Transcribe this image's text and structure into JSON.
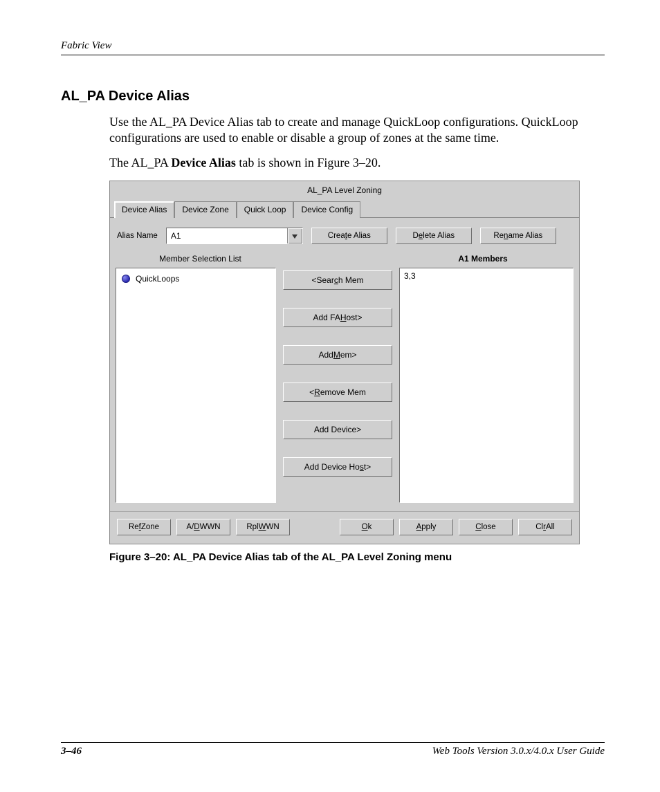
{
  "page": {
    "running_head": "Fabric View",
    "section_title": "AL_PA Device Alias",
    "para1": "Use the AL_PA Device Alias tab to create and manage QuickLoop configurations. QuickLoop configurations are used to enable or disable a group of zones at the same time.",
    "para2_pre": "The AL_PA ",
    "para2_bold": "Device Alias",
    "para2_post": " tab is shown in Figure 3–20.",
    "figure_caption": "Figure 3–20:  AL_PA Device Alias tab of the AL_PA Level Zoning menu",
    "footer_page": "3–46",
    "footer_doc": "Web Tools Version 3.0.x/4.0.x User Guide"
  },
  "app": {
    "window_title": "AL_PA Level Zoning",
    "tabs": {
      "t0": "Device Alias",
      "t1": "Device Zone",
      "t2": "Quick Loop",
      "t3": "Device Config"
    },
    "alias_label": "Alias Name",
    "alias_value": "A1",
    "btn_create_pre": "Crea",
    "btn_create_u": "t",
    "btn_create_post": "e Alias",
    "btn_delete_pre": "D",
    "btn_delete_u": "e",
    "btn_delete_post": "lete Alias",
    "btn_rename_pre": "Re",
    "btn_rename_u": "n",
    "btn_rename_post": "ame Alias",
    "hdr_left": "Member Selection List",
    "hdr_right": "A1 Members",
    "tree_item0": "QuickLoops",
    "right_item0": "3,3",
    "mid": {
      "search_pre": "<Sear",
      "search_u": "c",
      "search_post": "h Mem",
      "addfa_pre": "Add FA ",
      "addfa_u": "H",
      "addfa_post": "ost>",
      "addmem_pre": "Add ",
      "addmem_u": "M",
      "addmem_post": "em>",
      "remove_pre": "<",
      "remove_u": "R",
      "remove_post": "emove Mem",
      "adddev": "Add Device>",
      "adddevhost_pre": "Add Device Ho",
      "adddevhost_u": "s",
      "adddevhost_post": "t>"
    },
    "bottom": {
      "refzone_pre": "Re",
      "refzone_u": "f",
      "refzone_post": " Zone",
      "adwwn_pre": "A/",
      "adwwn_u": "D",
      "adwwn_post": " WWN",
      "rplwwn_pre": "Rpl ",
      "rplwwn_u": "W",
      "rplwwn_post": "WN",
      "ok_u": "O",
      "ok_post": "k",
      "apply_u": "A",
      "apply_post": "pply",
      "close_u": "C",
      "close_post": "lose",
      "clrall_pre": "Cl",
      "clrall_u": "r",
      "clrall_post": " All"
    }
  }
}
